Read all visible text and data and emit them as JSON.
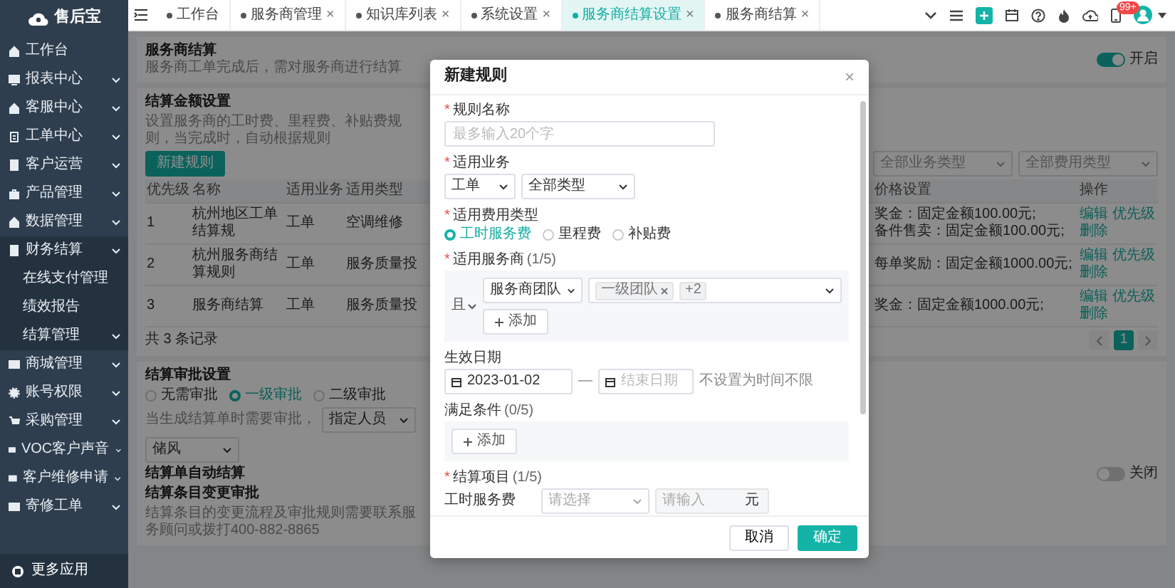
{
  "sidebar": {
    "logo_text": "售后宝",
    "items": [
      {
        "label": "工作台",
        "kind": "link"
      },
      {
        "label": "报表中心",
        "kind": "menu",
        "expanded": false
      },
      {
        "label": "客服中心",
        "kind": "menu",
        "expanded": false
      },
      {
        "label": "工单中心",
        "kind": "menu",
        "expanded": false
      },
      {
        "label": "客户运营",
        "kind": "menu",
        "expanded": false
      },
      {
        "label": "产品管理",
        "kind": "menu",
        "expanded": false
      },
      {
        "label": "数据管理",
        "kind": "menu",
        "expanded": false
      },
      {
        "label": "财务结算",
        "kind": "menu",
        "expanded": true,
        "children": [
          {
            "label": "在线支付管理",
            "kind": "link"
          },
          {
            "label": "绩效报告",
            "kind": "link"
          },
          {
            "label": "结算管理",
            "kind": "menu",
            "expanded": false
          }
        ]
      },
      {
        "label": "商城管理",
        "kind": "menu",
        "expanded": false
      },
      {
        "label": "账号权限",
        "kind": "menu",
        "expanded": false
      },
      {
        "label": "采购管理",
        "kind": "menu",
        "expanded": false
      },
      {
        "label": "VOC客户声音",
        "kind": "menu",
        "expanded": false
      },
      {
        "label": "客户维修申请",
        "kind": "menu",
        "expanded": false
      },
      {
        "label": "寄修工单",
        "kind": "menu",
        "expanded": false
      }
    ],
    "footer": "更多应用"
  },
  "tabs": [
    {
      "label": "工作台",
      "selected": false
    },
    {
      "label": "服务商管理",
      "selected": false,
      "close": "×"
    },
    {
      "label": "知识库列表",
      "selected": false,
      "close": "×"
    },
    {
      "label": "系统设置",
      "selected": false,
      "close": "×"
    },
    {
      "label": "服务商结算设置",
      "selected": true,
      "close": "×"
    },
    {
      "label": "服务商结算",
      "selected": false,
      "close": "×"
    }
  ],
  "toolbar": {
    "notification_badge": "99+"
  },
  "page_header": {
    "title": "服务商结算",
    "description": "服务商工单完成后，需对服务商进行结算",
    "switch": {
      "on": true,
      "label": "开启"
    }
  },
  "rules_card": {
    "title": "结算金额设置",
    "description": "设置服务商的工时费、里程费、补贴费规则，当完成时，自动根据规则",
    "new_button": "新建规则",
    "filters": [
      "全部业务类型",
      "全部费用类型"
    ],
    "table": {
      "columns": [
        "优先级",
        "名称",
        "适用业务",
        "适用类型",
        "价格设置",
        "操作"
      ],
      "rows": [
        {
          "priority": "1",
          "name": "杭州地区工单结算规",
          "business": "工单",
          "type": "空调维修",
          "price": [
            "奖金：固定金额100.00元;",
            "备件售卖：固定金额100.00元;"
          ],
          "actions": [
            "编辑",
            "优先级",
            "删除"
          ]
        },
        {
          "priority": "2",
          "name": "杭州服务商结算规则",
          "business": "工单",
          "type": "服务质量投",
          "price": [
            "每单奖励：固定金额1000.00元;"
          ],
          "actions": [
            "编辑",
            "优先级",
            "删除"
          ]
        },
        {
          "priority": "3",
          "name": "服务商结算",
          "business": "工单",
          "type": "服务质量投",
          "price": [
            "奖金：固定金额1000.00元;"
          ],
          "actions": [
            "编辑",
            "优先级",
            "删除"
          ]
        }
      ]
    },
    "total": "共 3 条记录",
    "pages": [
      {
        "label": "1",
        "selected": true
      }
    ]
  },
  "approval_card": {
    "title": "结算审批设置",
    "options": [
      {
        "label": "无需审批",
        "selected": false
      },
      {
        "label": "一级审批",
        "selected": true
      },
      {
        "label": "二级审批",
        "selected": false
      }
    ],
    "condition_label": "当生成结算单时需要审批，",
    "approver_type": "指定人员",
    "approver": "储风"
  },
  "auto_settle": {
    "title": "结算单自动结算",
    "switch": {
      "on": false,
      "label": "关闭"
    }
  },
  "change_approval": {
    "title": "结算条目变更审批",
    "description": "结算条目的变更流程及审批规则需要联系服务顾问或拨打400-882-8865"
  },
  "modal": {
    "title": "新建规则",
    "close": "×",
    "rule_name": {
      "required_mark": "*",
      "label": "规则名称",
      "placeholder": "最多输入20个字"
    },
    "business": {
      "required_mark": "*",
      "label": "适用业务",
      "values": [
        "工单",
        "全部类型"
      ]
    },
    "fee_type": {
      "required_mark": "*",
      "label": "适用费用类型",
      "options": [
        {
          "label": "工时服务费",
          "selected": true
        },
        {
          "label": "里程费",
          "selected": false
        },
        {
          "label": "补贴费",
          "selected": false
        }
      ]
    },
    "providers": {
      "required_mark": "*",
      "label": "适用服务商",
      "count": "(1/5)",
      "logic": "且",
      "field": "服务商团队",
      "tags": [
        "一级团队"
      ],
      "more": "+2",
      "add_button": "添加"
    },
    "date": {
      "label": "生效日期",
      "start": "2023-01-02",
      "separator": "—",
      "end_placeholder": "结束日期",
      "hint": "不设置为时间不限"
    },
    "conditions": {
      "label": "满足条件",
      "count": "(0/5)",
      "add_button": "添加"
    },
    "items": {
      "required_mark": "*",
      "label": "结算项目",
      "count": "(1/5)",
      "rows": [
        {
          "name": "工时服务费",
          "select_placeholder": "请选择",
          "amount_placeholder": "请输入",
          "unit": "元"
        }
      ]
    },
    "cancel": "取消",
    "ok": "确定"
  }
}
